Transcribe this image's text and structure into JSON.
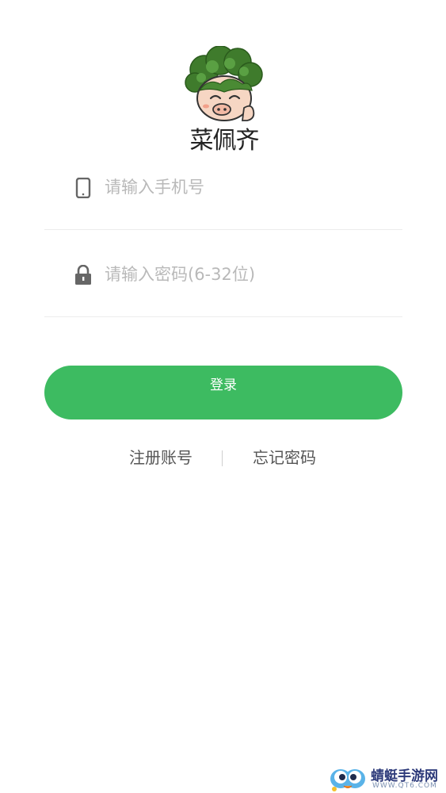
{
  "logo": {
    "wordmark": "菜佩齐",
    "icon": "cartoon-pig-with-broccoli-hair-icon"
  },
  "form": {
    "phone_placeholder": "请输入手机号",
    "password_placeholder": "请输入密码(6-32位)",
    "phone_icon": "phone-icon",
    "lock_icon": "lock-icon"
  },
  "actions": {
    "login_label": "登录",
    "register_label": "注册账号",
    "forgot_label": "忘记密码"
  },
  "watermark": {
    "title": "蜻蜓手游网",
    "url": "WWW.QT6.COM"
  },
  "colors": {
    "primary": "#3dbb61",
    "background": "#ffffff",
    "placeholder": "#b9b9b9",
    "link": "#555555"
  }
}
